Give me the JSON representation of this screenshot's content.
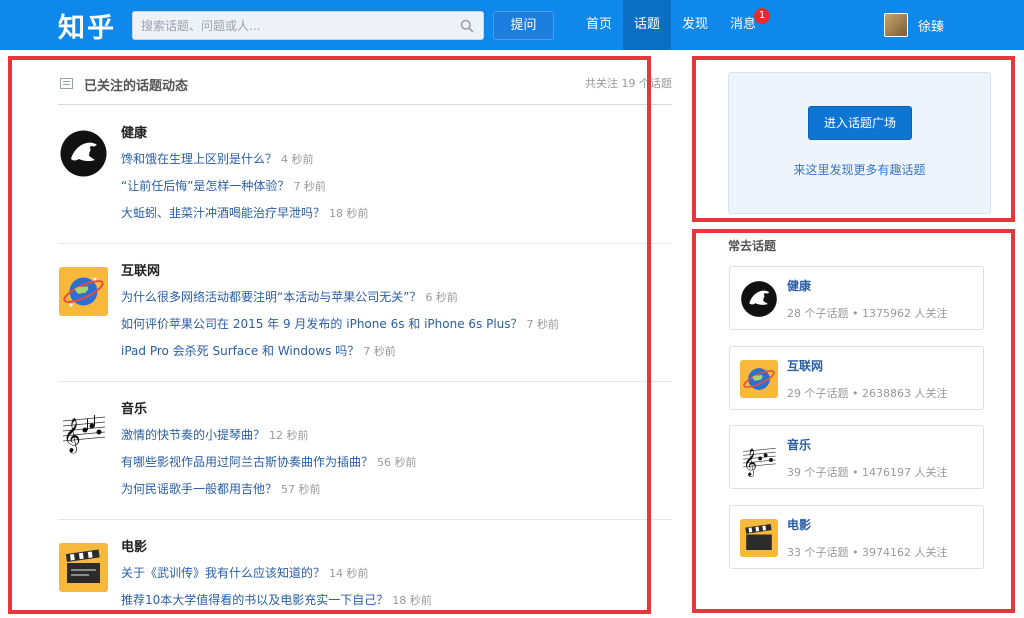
{
  "header": {
    "logo": "知乎",
    "search_placeholder": "搜索话题、问题或人...",
    "ask_label": "提问",
    "nav": [
      {
        "label": "首页",
        "active": false
      },
      {
        "label": "话题",
        "active": true
      },
      {
        "label": "发现",
        "active": false
      },
      {
        "label": "消息",
        "active": false,
        "badge": "1"
      }
    ],
    "username": "徐臻",
    "colors": {
      "bar": "#0f88eb",
      "active_tab": "#0a6fc2",
      "badge": "#e02d2d"
    }
  },
  "feed": {
    "title": "已关注的话题动态",
    "count_text": "共关注 19 个话题",
    "topics": [
      {
        "name": "健康",
        "icon": "health-icon",
        "questions": [
          {
            "text": "馋和饿在生理上区别是什么？",
            "time": "4 秒前"
          },
          {
            "text": "“让前任后悔”是怎样一种体验？",
            "time": "7 秒前"
          },
          {
            "text": "大蚯蚓、韭菜汁冲酒喝能治疗早泄吗？",
            "time": "18 秒前"
          }
        ]
      },
      {
        "name": "互联网",
        "icon": "internet-icon",
        "questions": [
          {
            "text": "为什么很多网络活动都要注明“本活动与苹果公司无关”？",
            "time": "6 秒前"
          },
          {
            "text": "如何评价苹果公司在 2015 年 9 月发布的 iPhone 6s 和 iPhone 6s Plus？",
            "time": "7 秒前"
          },
          {
            "text": "iPad Pro 会杀死 Surface 和 Windows 吗？",
            "time": "7 秒前"
          }
        ]
      },
      {
        "name": "音乐",
        "icon": "music-icon",
        "questions": [
          {
            "text": "激情的快节奏的小提琴曲？",
            "time": "12 秒前"
          },
          {
            "text": "有哪些影视作品用过阿兰古斯协奏曲作为插曲？",
            "time": "56 秒前"
          },
          {
            "text": "为何民谣歌手一般都用吉他？",
            "time": "57 秒前"
          }
        ]
      },
      {
        "name": "电影",
        "icon": "movie-icon",
        "questions": [
          {
            "text": "关于《武训传》我有什么应该知道的？",
            "time": "14 秒前"
          },
          {
            "text": "推荐10本大学值得看的书以及电影充实一下自己？",
            "time": "18 秒前"
          }
        ]
      }
    ]
  },
  "sidebar": {
    "promo_button": "进入话题广场",
    "promo_link": "来这里发现更多有趣话题",
    "frequent_title": "常去话题",
    "frequent": [
      {
        "name": "健康",
        "icon": "health-icon",
        "meta": "28 个子话题 • 1375962 人关注"
      },
      {
        "name": "互联网",
        "icon": "internet-icon",
        "meta": "29 个子话题 • 2638863 人关注"
      },
      {
        "name": "音乐",
        "icon": "music-icon",
        "meta": "39 个子话题 • 1476197 人关注"
      },
      {
        "name": "电影",
        "icon": "movie-icon",
        "meta": "33 个子话题 • 3974162 人关注"
      }
    ]
  },
  "highlight_color": "#e8363c"
}
